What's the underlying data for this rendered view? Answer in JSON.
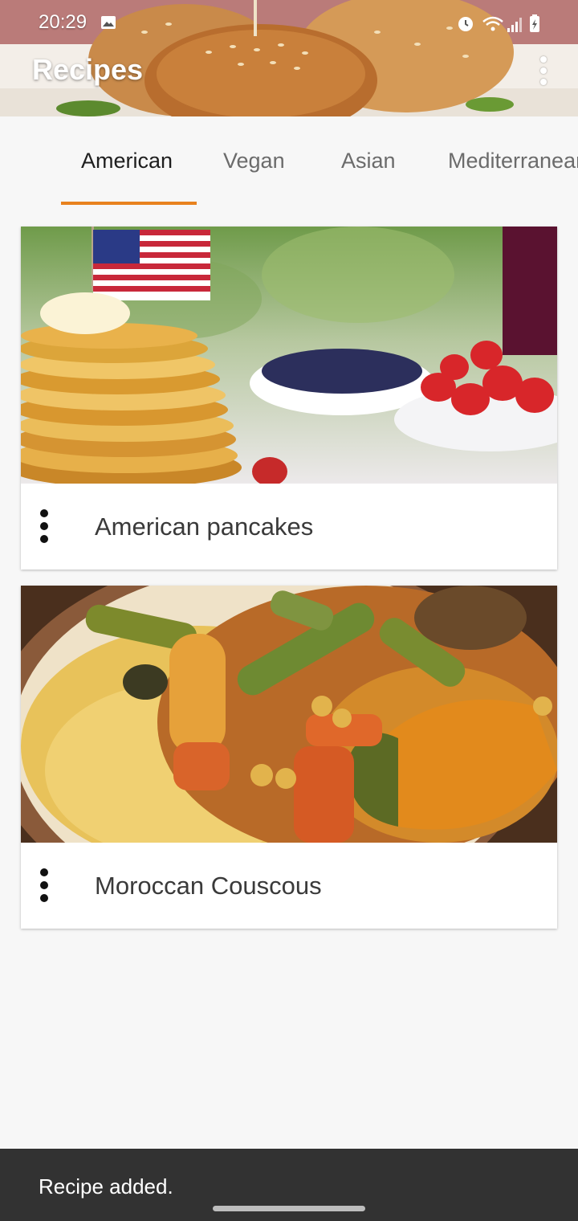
{
  "status_bar": {
    "time": "20:29",
    "icons": [
      "gallery-icon",
      "alarm-icon",
      "wifi-icon",
      "signal-icon",
      "battery-icon"
    ]
  },
  "app_bar": {
    "title": "Recipes",
    "menu_icon": "more-vert-icon"
  },
  "tabs": [
    {
      "label": "American",
      "active": true
    },
    {
      "label": "Vegan",
      "active": false
    },
    {
      "label": "Asian",
      "active": false
    },
    {
      "label": "Mediterranean",
      "active": false
    }
  ],
  "recipes": [
    {
      "title": "American pancakes",
      "menu_icon": "more-vert-icon"
    },
    {
      "title": "Moroccan Couscous",
      "menu_icon": "more-vert-icon"
    }
  ],
  "snackbar": {
    "message": "Recipe added."
  },
  "colors": {
    "accent": "#e8821e",
    "background": "#f7f7f7",
    "snackbar": "#323232"
  }
}
